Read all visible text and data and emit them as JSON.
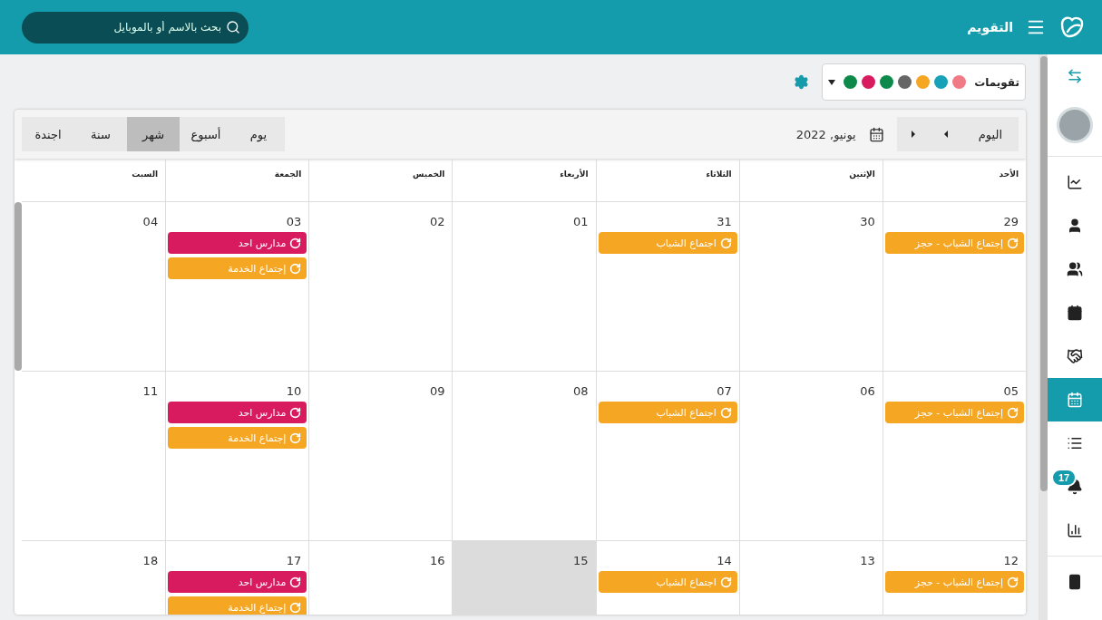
{
  "header": {
    "title": "التقويم",
    "search": {
      "placeholder": "بحث بالاسم أو بالموبايل"
    }
  },
  "calendars_filter": {
    "label": "تقويمات",
    "colors": [
      {
        "color": "#f07b86"
      },
      {
        "color": "#17a2b8"
      },
      {
        "color": "#f5a623"
      },
      {
        "color": "#666666"
      },
      {
        "color": "#0d8a4a"
      },
      {
        "color": "#d81b5f"
      },
      {
        "color": "#0d8a4a"
      }
    ]
  },
  "toolbar": {
    "today_button": "اليوم",
    "period": "يونيو, 2022",
    "views": [
      {
        "label": "يوم",
        "selected": false
      },
      {
        "label": "أسبوع",
        "selected": false
      },
      {
        "label": "شهر",
        "selected": true
      },
      {
        "label": "سنة",
        "selected": false
      },
      {
        "label": "اجندة",
        "selected": false
      }
    ]
  },
  "weekdays": [
    "الأحد",
    "الإثنين",
    "الثلاثاء",
    "الأربعاء",
    "الخميس",
    "الجمعة",
    "السبت"
  ],
  "weeks": [
    {
      "days": [
        {
          "date": "29",
          "today": false,
          "events": [
            {
              "title": "إجتماع الشباب - حجز",
              "color": "#f5a623"
            }
          ]
        },
        {
          "date": "30",
          "today": false
        },
        {
          "date": "31",
          "today": false,
          "events": [
            {
              "title": "اجتماع الشباب",
              "color": "#f5a623"
            }
          ]
        },
        {
          "date": "01",
          "today": false
        },
        {
          "date": "02",
          "today": false
        },
        {
          "date": "03",
          "today": false,
          "events": [
            {
              "title": "مدارس احد",
              "color": "#d81b5f"
            },
            {
              "title": "إجتماع الخدمة",
              "color": "#f5a623"
            }
          ]
        },
        {
          "date": "04",
          "today": false
        }
      ]
    },
    {
      "days": [
        {
          "date": "05",
          "today": false,
          "events": [
            {
              "title": "إجتماع الشباب - حجز",
              "color": "#f5a623"
            }
          ]
        },
        {
          "date": "06",
          "today": false
        },
        {
          "date": "07",
          "today": false,
          "events": [
            {
              "title": "اجتماع الشباب",
              "color": "#f5a623"
            }
          ]
        },
        {
          "date": "08",
          "today": false
        },
        {
          "date": "09",
          "today": false
        },
        {
          "date": "10",
          "today": false,
          "events": [
            {
              "title": "مدارس احد",
              "color": "#d81b5f"
            },
            {
              "title": "إجتماع الخدمة",
              "color": "#f5a623"
            }
          ]
        },
        {
          "date": "11",
          "today": false
        }
      ]
    },
    {
      "days": [
        {
          "date": "12",
          "today": false,
          "events": [
            {
              "title": "إجتماع الشباب - حجز",
              "color": "#f5a623"
            }
          ]
        },
        {
          "date": "13",
          "today": false
        },
        {
          "date": "14",
          "today": false,
          "events": [
            {
              "title": "اجتماع الشباب",
              "color": "#f5a623"
            }
          ]
        },
        {
          "date": "15",
          "today": true
        },
        {
          "date": "16",
          "today": false
        },
        {
          "date": "17",
          "today": false,
          "events": [
            {
              "title": "مدارس احد",
              "color": "#d81b5f"
            },
            {
              "title": "إجتماع الخدمة",
              "color": "#f5a623"
            }
          ]
        },
        {
          "date": "18",
          "today": false
        }
      ]
    }
  ],
  "sidebar": {
    "items": [
      {
        "selected": false
      },
      {
        "selected": false
      },
      {
        "selected": false
      },
      {
        "selected": false
      },
      {
        "selected": false
      },
      {
        "selected": true
      },
      {
        "selected": false
      },
      {
        "selected": false,
        "badge": "17"
      },
      {
        "selected": false
      },
      {
        "selected": false
      }
    ]
  }
}
